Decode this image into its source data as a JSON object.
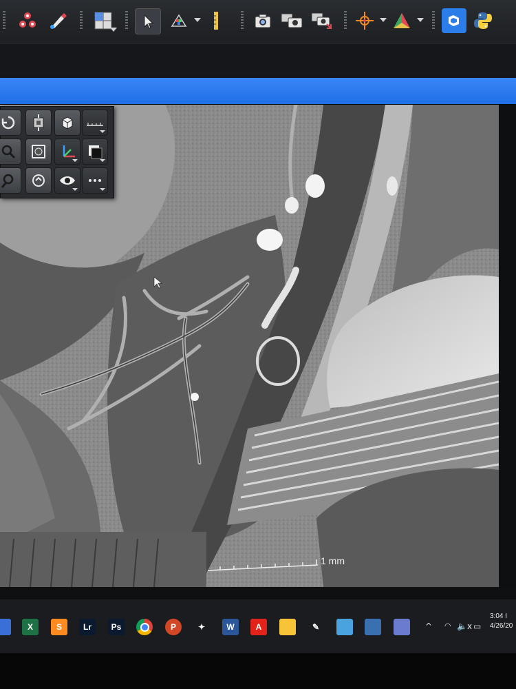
{
  "toolbar": {
    "icons": [
      "molecule-icon",
      "color-edit-icon",
      "grid-layout-icon",
      "pointer-icon",
      "color-palette-icon",
      "ruler-icon",
      "snapshot-icon",
      "snapshot-multi-icon",
      "snapshot-export-icon",
      "crosshair-icon",
      "orientation-axes-icon",
      "plugin-icon",
      "python-icon"
    ]
  },
  "palette": {
    "icons": [
      "rotate-icon",
      "pan-icon",
      "cube-view-icon",
      "scale-ruler-icon",
      "zoom-icon",
      "zoom-fit-icon",
      "axes-icon",
      "background-icon",
      "zoom-out-icon",
      "reset-view-icon",
      "eye-visibility-icon",
      "more-options-icon"
    ]
  },
  "viewport": {
    "scale_bar_label": "1 mm"
  },
  "taskbar": {
    "apps": [
      {
        "name": "excel",
        "label": "X",
        "color": "#1e7145"
      },
      {
        "name": "sublime",
        "label": "S",
        "color": "#ff8a1f"
      },
      {
        "name": "lightroom",
        "label": "Lr",
        "color": "#0b1a2e"
      },
      {
        "name": "photoshop",
        "label": "Ps",
        "color": "#0b1a2e"
      },
      {
        "name": "chrome",
        "label": "",
        "color": "#db4437"
      },
      {
        "name": "powerpoint",
        "label": "P",
        "color": "#d24726"
      },
      {
        "name": "tidal",
        "label": "✦",
        "color": "#1a1c20"
      },
      {
        "name": "word",
        "label": "W",
        "color": "#2b579a"
      },
      {
        "name": "acrobat",
        "label": "A",
        "color": "#e2231a"
      },
      {
        "name": "file-explorer",
        "label": "",
        "color": "#f8c437"
      },
      {
        "name": "pen-tool",
        "label": "✎",
        "color": "#1a1c20"
      },
      {
        "name": "photos",
        "label": "",
        "color": "#4aa3df"
      },
      {
        "name": "python",
        "label": "",
        "color": "#3a6fb0"
      },
      {
        "name": "viewer-app",
        "label": "",
        "color": "#6a7bd0"
      }
    ],
    "tray": {
      "chevron": "^",
      "volume": "🔈x",
      "time": "3:04 I",
      "date": "4/26/20"
    }
  },
  "colors": {
    "title_bar": "#1f6fe6",
    "toolbar_bg": "#1d1f22",
    "taskbar_bg": "#1a1c20"
  }
}
